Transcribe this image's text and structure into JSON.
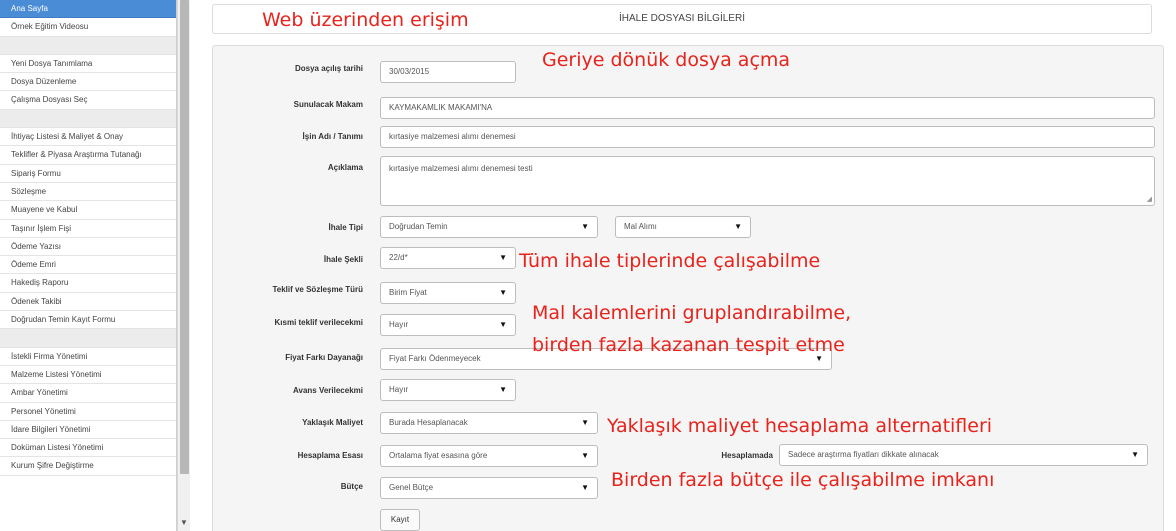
{
  "sidebar": {
    "items": [
      {
        "label": "Ana Sayfa",
        "active": true
      },
      {
        "label": "Örnek Eğitim Videosu"
      },
      {
        "label": "",
        "spacer": true
      },
      {
        "label": "Yeni Dosya Tanımlama"
      },
      {
        "label": "Dosya Düzenleme"
      },
      {
        "label": "Çalışma Dosyası Seç"
      },
      {
        "label": "",
        "spacer": true
      },
      {
        "label": "İhtiyaç Listesi & Maliyet & Onay"
      },
      {
        "label": "Teklifler & Piyasa Araştırma Tutanağı"
      },
      {
        "label": "Sipariş Formu"
      },
      {
        "label": "Sözleşme"
      },
      {
        "label": "Muayene ve Kabul"
      },
      {
        "label": "Taşınır İşlem Fişi"
      },
      {
        "label": "Ödeme Yazısı"
      },
      {
        "label": "Ödeme Emri"
      },
      {
        "label": "Hakediş Raporu"
      },
      {
        "label": "Ödenek Takibi"
      },
      {
        "label": "Doğrudan Temin Kayıt Formu"
      },
      {
        "label": "",
        "spacer": true
      },
      {
        "label": "İstekli Firma Yönetimi"
      },
      {
        "label": "Malzeme Listesi Yönetimi"
      },
      {
        "label": "Ambar Yönetimi"
      },
      {
        "label": "Personel Yönetimi"
      },
      {
        "label": "İdare Bilgileri Yönetimi"
      },
      {
        "label": "Doküman Listesi Yönetimi"
      },
      {
        "label": "Kurum Şifre Değiştirme"
      }
    ]
  },
  "header": {
    "title": "İHALE DOSYASI BİLGİLERİ"
  },
  "form": {
    "dosya_acilis": {
      "label": "Dosya açılış tarihi",
      "value": "30/03/2015"
    },
    "sunulacak_makam": {
      "label": "Sunulacak Makam",
      "value": "KAYMAKAMLIK MAKAMI'NA"
    },
    "isin_adi": {
      "label": "İşin Adı / Tanımı",
      "value": "kırtasiye malzemesi alımı denemesi"
    },
    "aciklama": {
      "label": "Açıklama",
      "value": "kırtasiye malzemesi alımı denemesi testi"
    },
    "ihale_tipi": {
      "label": "İhale Tipi",
      "value": "Doğrudan Temin",
      "value2": "Mal Alımı"
    },
    "ihale_sekli": {
      "label": "İhale Şekli",
      "value": "22/d*"
    },
    "teklif_turu": {
      "label": "Teklif ve Sözleşme Türü",
      "value": "Birim Fiyat"
    },
    "kismi_teklif": {
      "label": "Kısmi teklif verilecekmi",
      "value": "Hayır"
    },
    "fiyat_farki": {
      "label": "Fiyat Farkı Dayanağı",
      "value": "Fiyat Farkı Ödenmeyecek"
    },
    "avans": {
      "label": "Avans Verilecekmi",
      "value": "Hayır"
    },
    "yaklasik_maliyet": {
      "label": "Yaklaşık Maliyet",
      "value": "Burada Hesaplanacak"
    },
    "hesaplama_esasi": {
      "label": "Hesaplama Esası",
      "value": "Ortalama fiyat esasına göre"
    },
    "hesaplamada": {
      "label": "Hesaplamada",
      "value": "Sadece araştırma fiyatları dikkate alınacak"
    },
    "butce": {
      "label": "Bütçe",
      "value": "Genel Bütçe"
    },
    "kayit_label": "Kayıt"
  },
  "annotations": {
    "web": "Web üzerinden erişim",
    "geriye": "Geriye dönük dosya açma",
    "tum_ihale": "Tüm ihale tiplerinde çalışabilme",
    "mal_kalemleri_1": "Mal kalemlerini gruplandırabilme,",
    "mal_kalemleri_2": "birden fazla kazanan tespit etme",
    "yaklasik": "Yaklaşık maliyet hesaplama alternatifleri",
    "butce": "Birden fazla bütçe ile çalışabilme imkanı"
  },
  "colors": {
    "accent": "#4a8cd6",
    "annotation": "#e8231c",
    "panel": "#f5f5f5"
  }
}
